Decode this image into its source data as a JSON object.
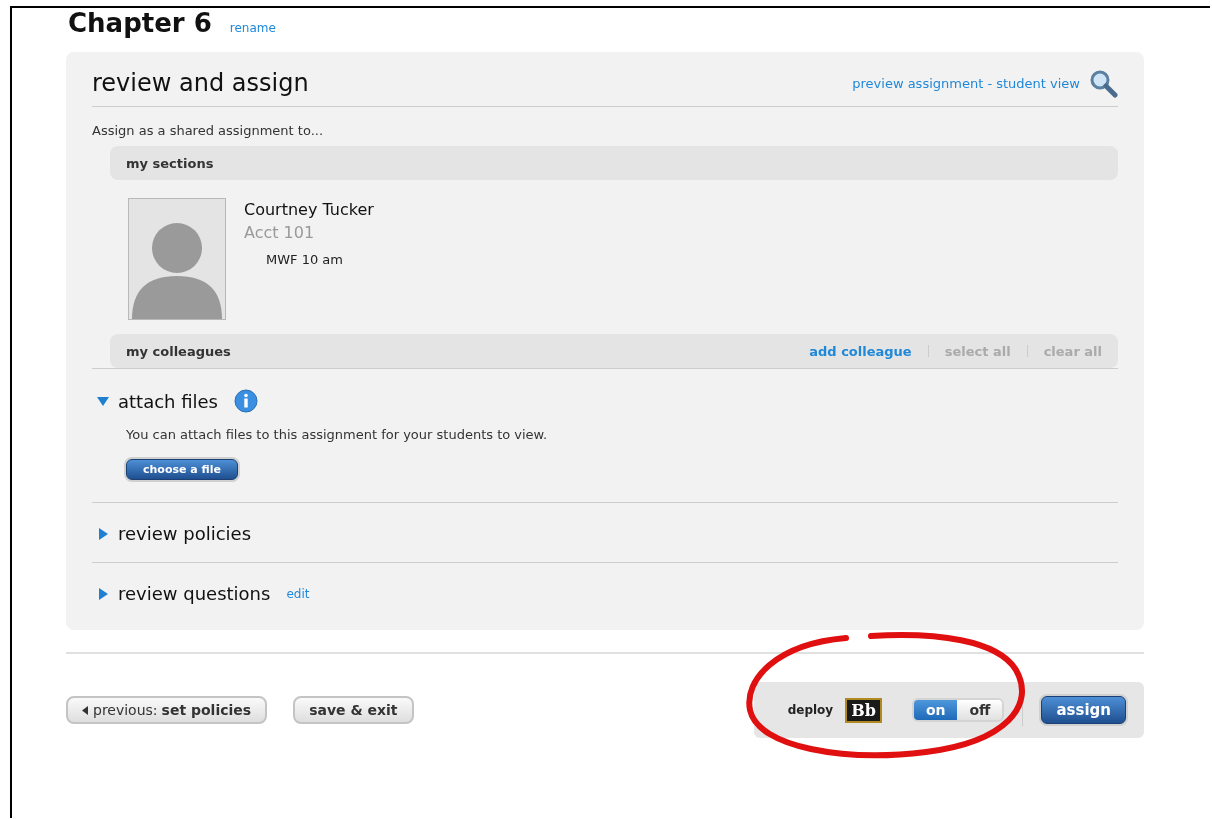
{
  "page": {
    "title": "Chapter 6",
    "rename_link": "rename"
  },
  "panel": {
    "title": "review and assign",
    "preview_link": "preview assignment - student view",
    "assign_intro": "Assign as a shared assignment to...",
    "my_sections": {
      "label": "my sections",
      "sections": [
        {
          "instructor": "Courtney Tucker",
          "course": "Acct 101",
          "schedule": "MWF 10 am"
        }
      ]
    },
    "my_colleagues": {
      "label": "my colleagues",
      "actions": [
        {
          "label": "add colleague",
          "disabled": false
        },
        {
          "label": "select all",
          "disabled": true
        },
        {
          "label": "clear all",
          "disabled": true
        }
      ]
    },
    "sections": [
      {
        "title": "attach files",
        "expanded": true,
        "info": true,
        "description": "You can attach files to this assignment for your students to view.",
        "button": "choose a file"
      },
      {
        "title": "review policies",
        "expanded": false,
        "info": false
      },
      {
        "title": "review questions",
        "expanded": false,
        "info": false,
        "link": "edit"
      }
    ]
  },
  "footer": {
    "previous_button": {
      "prefix": "previous:",
      "label": "set policies"
    },
    "save_button": "save & exit",
    "deploy_label": "deploy",
    "deploy_logo": "Bb",
    "toggle": [
      {
        "label": "on",
        "selected": true
      },
      {
        "label": "off",
        "selected": false
      }
    ],
    "assign_button": "assign"
  }
}
